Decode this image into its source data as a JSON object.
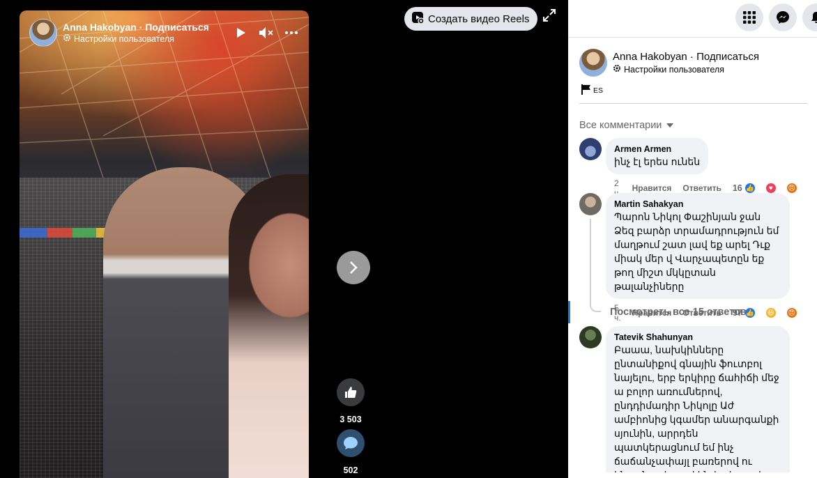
{
  "video": {
    "author": "Anna Hakobyan · Подписаться",
    "settings_label": "Настройки пользователя",
    "likes": "3 503",
    "comments_count": "502"
  },
  "stage": {
    "reels_label": "Создать видео Reels"
  },
  "post": {
    "author": "Anna Hakobyan · Подписаться",
    "settings_label": "Настройки пользователя",
    "flag_label": "ES"
  },
  "comments_section": {
    "sort_label": "Все комментарии",
    "view_replies": "Посмотреть все 15 ответов",
    "items": [
      {
        "name": "Armen Armen",
        "text": "ինչ էլ երես ունեն",
        "time": "2 ч.",
        "like": "Нравится",
        "reply": "Ответить",
        "reaction_count": "16"
      },
      {
        "name": "Martin Sahakyan",
        "text": "Պարոն Նիկոլ Փաշինյան ջան Ձեզ բարձր տրամադրություն եմ մաղթում շատ լավ եք արել Դւք միակ մեր վ Վարչապետըն եք թող միշտ մկկըտան թալանչիները",
        "time": "5 ч.",
        "like": "Нравится",
        "reply": "Ответить",
        "reaction_count": "97"
      },
      {
        "name": "Tatevik Shahunyan",
        "text": "Բաաա, նախկինները ընտանիքով գնային ֆուտբոլ նայելու, երբ երկիրը ճահիճի մեջ ա բոլոր առումներով, ընդդիմադիր Նիկոլը Աժ ամբիոնից կգամեր անարգանքի սյունին, արրդեն պատկերացնում եմ ինչ ճաճանչափայլ բառերով ու ինտոնացիայով ինչեր էր ասելու"
      }
    ]
  }
}
